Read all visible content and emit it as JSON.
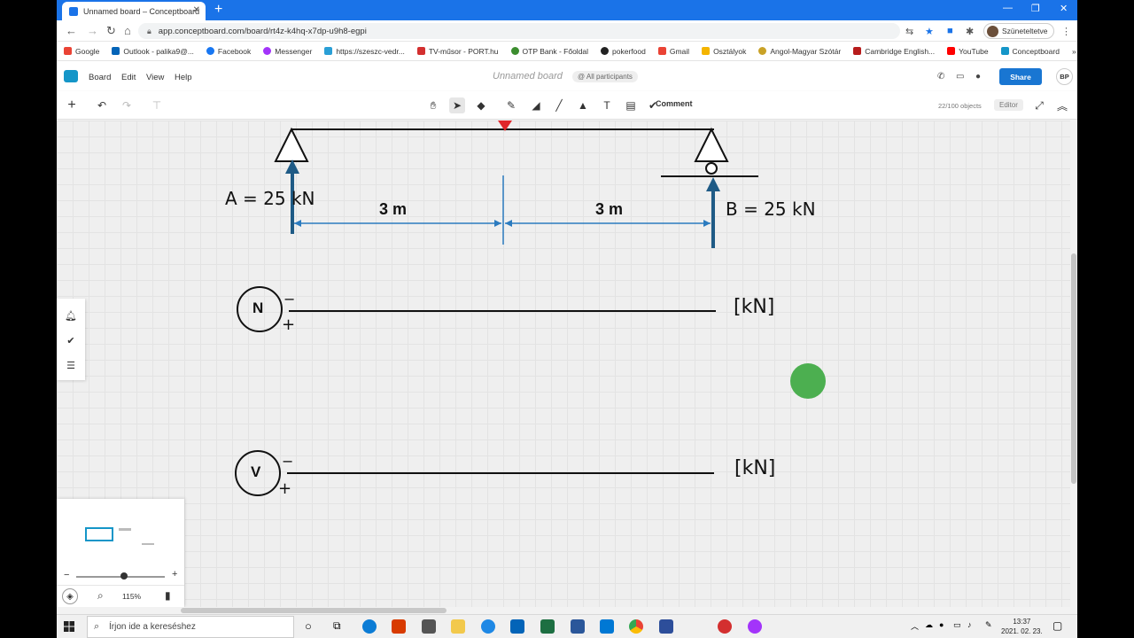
{
  "browser": {
    "tab_title": "Unnamed board – Conceptboard",
    "url": "app.conceptboard.com/board/rt4z-k4hq-x7dp-u9h8-egpi",
    "profile_label": "Szüneteltetve",
    "bookmarks": [
      "Google",
      "Outlook - palika9@...",
      "Facebook",
      "Messenger",
      "https://szeszc-vedr...",
      "TV-műsor - PORT.hu",
      "OTP Bank - Főoldal",
      "pokerfood",
      "Gmail",
      "Osztályok",
      "Angol-Magyar Szótár",
      "Cambridge English...",
      "YouTube",
      "Conceptboard"
    ]
  },
  "app": {
    "menu": [
      "Board",
      "Edit",
      "View",
      "Help"
    ],
    "board_title": "Unnamed board",
    "participants": "@ All participants",
    "share_label": "Share",
    "user_initials": "BP",
    "comment_label": "Comment",
    "object_count": "22/100 objects",
    "role_badge": "Editor",
    "zoom_level": "115%"
  },
  "board": {
    "reaction_a": "A = 25 kN",
    "reaction_b": "B = 25 kN",
    "span_left": "3 m",
    "span_right": "3 m",
    "n_label": "N",
    "v_label": "V",
    "minus": "−",
    "plus": "+",
    "unit_n": "[kN]",
    "unit_v": "[kN]"
  },
  "taskbar": {
    "search_placeholder": "Írjon ide a kereséshez",
    "time": "13:37",
    "date": "2021. 02. 23."
  },
  "colors": {
    "accent": "#1976d2",
    "arrow": "#1f5b86",
    "marker_red": "#e0262a",
    "green_dot": "#4caf50"
  }
}
